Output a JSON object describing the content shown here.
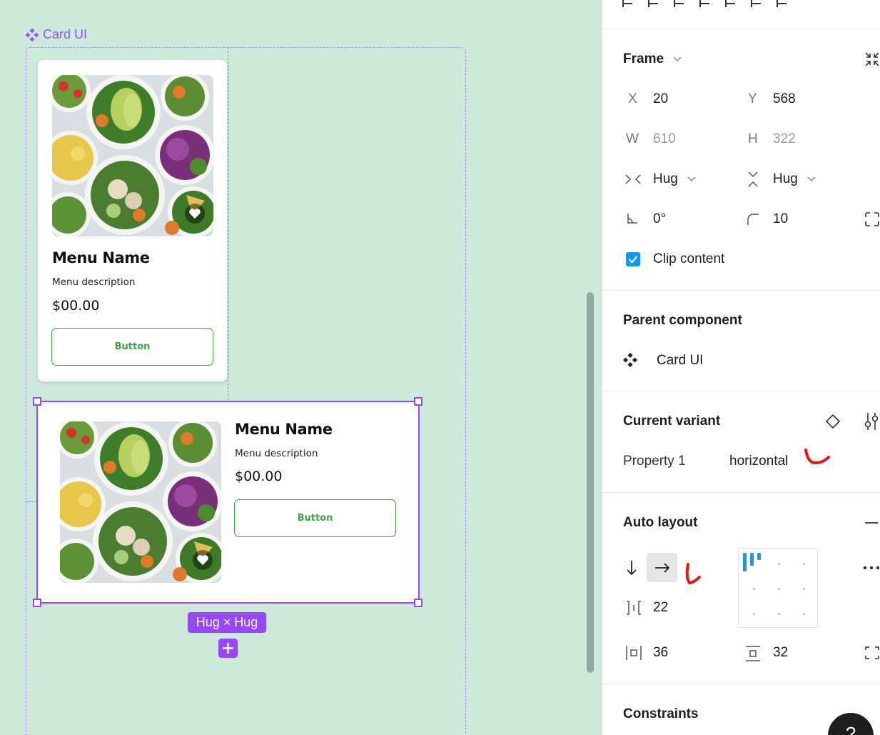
{
  "canvas": {
    "component_set_label": "Card UI",
    "cards": [
      {
        "variant": "vertical",
        "menu_name": "Menu Name",
        "menu_description": "Menu description",
        "price": "$00.00",
        "button_label": "Button"
      },
      {
        "variant": "horizontal",
        "menu_name": "Menu Name",
        "menu_description": "Menu description",
        "price": "$00.00",
        "button_label": "Button"
      }
    ],
    "size_badge": "Hug × Hug",
    "colors": {
      "canvas_bg": "#cde9d9",
      "selection": "#9747ff",
      "component_purple": "#8b5cf6",
      "button_green": "#3ea34b",
      "guide_blue": "#38a5ee"
    }
  },
  "panel": {
    "frame": {
      "title": "Frame",
      "x_label": "X",
      "x_value": "20",
      "y_label": "Y",
      "y_value": "568",
      "w_label": "W",
      "w_value": "610",
      "h_label": "H",
      "h_value": "322",
      "width_mode": "Hug",
      "height_mode": "Hug",
      "rotation": "0°",
      "corner_radius": "10",
      "clip_content_label": "Clip content",
      "clip_content_checked": true
    },
    "parent_component": {
      "title": "Parent component",
      "name": "Card UI"
    },
    "current_variant": {
      "title": "Current variant",
      "property_name": "Property 1",
      "property_value": "horizontal"
    },
    "auto_layout": {
      "title": "Auto layout",
      "direction": "horizontal",
      "gap": "22",
      "horizontal_padding": "36",
      "vertical_padding": "32"
    },
    "constraints": {
      "title": "Constraints"
    },
    "help_label": "?",
    "colors": {
      "checkbox": "#0d99ff",
      "annotation_red": "#e01818"
    }
  }
}
